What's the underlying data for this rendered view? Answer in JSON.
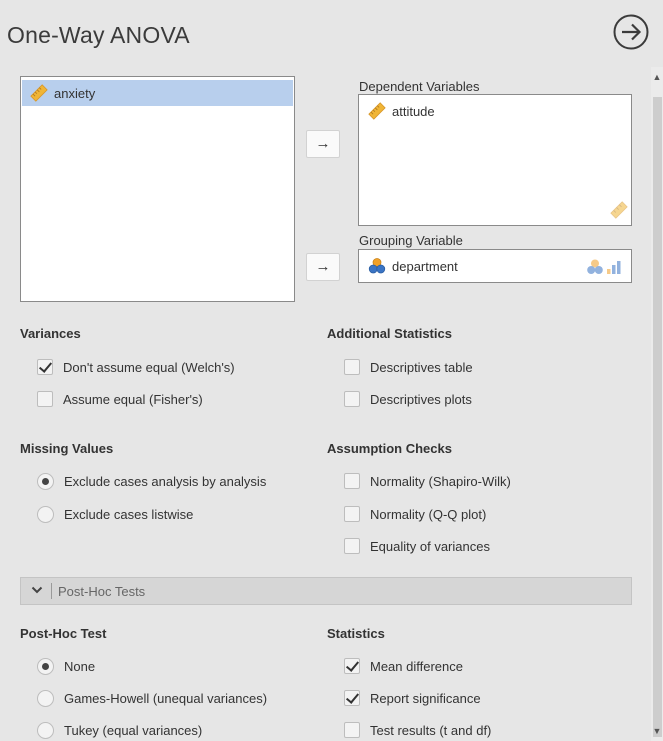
{
  "title": "One-Way ANOVA",
  "source_variables": [
    {
      "name": "anxiety",
      "type": "continuous-ruler-icon",
      "selected": true
    }
  ],
  "dependent": {
    "label": "Dependent Variables",
    "items": [
      {
        "name": "attitude",
        "type": "continuous-ruler-icon"
      }
    ]
  },
  "grouping": {
    "label": "Grouping Variable",
    "value": "department",
    "type": "nominal-circles-icon"
  },
  "arrow_glyph": "→",
  "variances": {
    "title": "Variances",
    "options": [
      {
        "label": "Don't assume equal (Welch's)",
        "checked": true
      },
      {
        "label": "Assume equal (Fisher's)",
        "checked": false
      }
    ]
  },
  "additional_statistics": {
    "title": "Additional Statistics",
    "options": [
      {
        "label": "Descriptives table",
        "checked": false
      },
      {
        "label": "Descriptives plots",
        "checked": false
      }
    ]
  },
  "missing_values": {
    "title": "Missing Values",
    "options": [
      {
        "label": "Exclude cases analysis by analysis",
        "selected": true
      },
      {
        "label": "Exclude cases listwise",
        "selected": false
      }
    ]
  },
  "assumption_checks": {
    "title": "Assumption Checks",
    "options": [
      {
        "label": "Normality (Shapiro-Wilk)",
        "checked": false
      },
      {
        "label": "Normality (Q-Q plot)",
        "checked": false
      },
      {
        "label": "Equality of variances",
        "checked": false
      }
    ]
  },
  "posthoc_section": {
    "label": "Post-Hoc Tests",
    "icon": "chevron-down-icon"
  },
  "posthoc_test": {
    "title": "Post-Hoc Test",
    "options": [
      {
        "label": "None",
        "selected": true
      },
      {
        "label": "Games-Howell (unequal variances)",
        "selected": false
      },
      {
        "label": "Tukey (equal variances)",
        "selected": false
      }
    ]
  },
  "statistics": {
    "title": "Statistics",
    "options": [
      {
        "label": "Mean difference",
        "checked": true
      },
      {
        "label": "Report significance",
        "checked": true
      },
      {
        "label": "Test results (t and df)",
        "checked": false
      }
    ]
  },
  "colors": {
    "selected_row": "#b8cfed",
    "ruler_icon": "#f0b536",
    "nominal_blue": "#3a74c4",
    "nominal_orange": "#f0a028"
  }
}
